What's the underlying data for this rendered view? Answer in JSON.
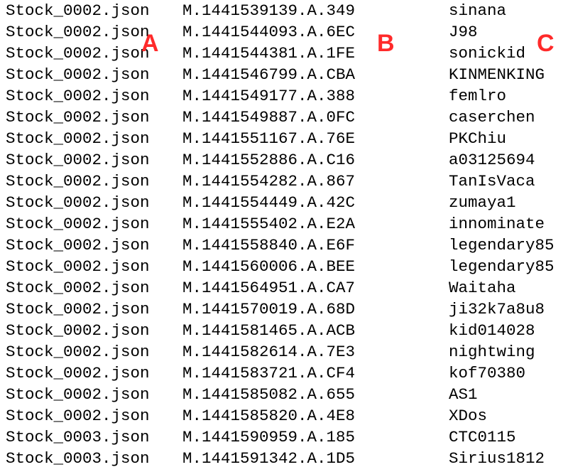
{
  "markers": {
    "color": "#ff2a2a",
    "a": "A",
    "b": "B",
    "c": "C"
  },
  "rows": [
    {
      "file": "Stock_0002.json",
      "id": "M.1441539139.A.349",
      "user": "sinana"
    },
    {
      "file": "Stock_0002.json",
      "id": "M.1441544093.A.6EC",
      "user": "J98"
    },
    {
      "file": "Stock_0002.json",
      "id": "M.1441544381.A.1FE",
      "user": "sonickid"
    },
    {
      "file": "Stock_0002.json",
      "id": "M.1441546799.A.CBA",
      "user": "KINMENKING"
    },
    {
      "file": "Stock_0002.json",
      "id": "M.1441549177.A.388",
      "user": "femlro"
    },
    {
      "file": "Stock_0002.json",
      "id": "M.1441549887.A.0FC",
      "user": "caserchen"
    },
    {
      "file": "Stock_0002.json",
      "id": "M.1441551167.A.76E",
      "user": "PKChiu"
    },
    {
      "file": "Stock_0002.json",
      "id": "M.1441552886.A.C16",
      "user": "a03125694"
    },
    {
      "file": "Stock_0002.json",
      "id": "M.1441554282.A.867",
      "user": "TanIsVaca"
    },
    {
      "file": "Stock_0002.json",
      "id": "M.1441554449.A.42C",
      "user": "zumaya1"
    },
    {
      "file": "Stock_0002.json",
      "id": "M.1441555402.A.E2A",
      "user": "innominate"
    },
    {
      "file": "Stock_0002.json",
      "id": "M.1441558840.A.E6F",
      "user": "legendary85"
    },
    {
      "file": "Stock_0002.json",
      "id": "M.1441560006.A.BEE",
      "user": "legendary85"
    },
    {
      "file": "Stock_0002.json",
      "id": "M.1441564951.A.CA7",
      "user": "Waitaha"
    },
    {
      "file": "Stock_0002.json",
      "id": "M.1441570019.A.68D",
      "user": "ji32k7a8u8"
    },
    {
      "file": "Stock_0002.json",
      "id": "M.1441581465.A.ACB",
      "user": "kid014028"
    },
    {
      "file": "Stock_0002.json",
      "id": "M.1441582614.A.7E3",
      "user": "nightwing"
    },
    {
      "file": "Stock_0002.json",
      "id": "M.1441583721.A.CF4",
      "user": "kof70380"
    },
    {
      "file": "Stock_0002.json",
      "id": "M.1441585082.A.655",
      "user": "AS1"
    },
    {
      "file": "Stock_0002.json",
      "id": "M.1441585820.A.4E8",
      "user": "XDos"
    },
    {
      "file": "Stock_0003.json",
      "id": "M.1441590959.A.185",
      "user": "CTC0115"
    },
    {
      "file": "Stock_0003.json",
      "id": "M.1441591342.A.1D5",
      "user": "Sirius1812"
    }
  ]
}
